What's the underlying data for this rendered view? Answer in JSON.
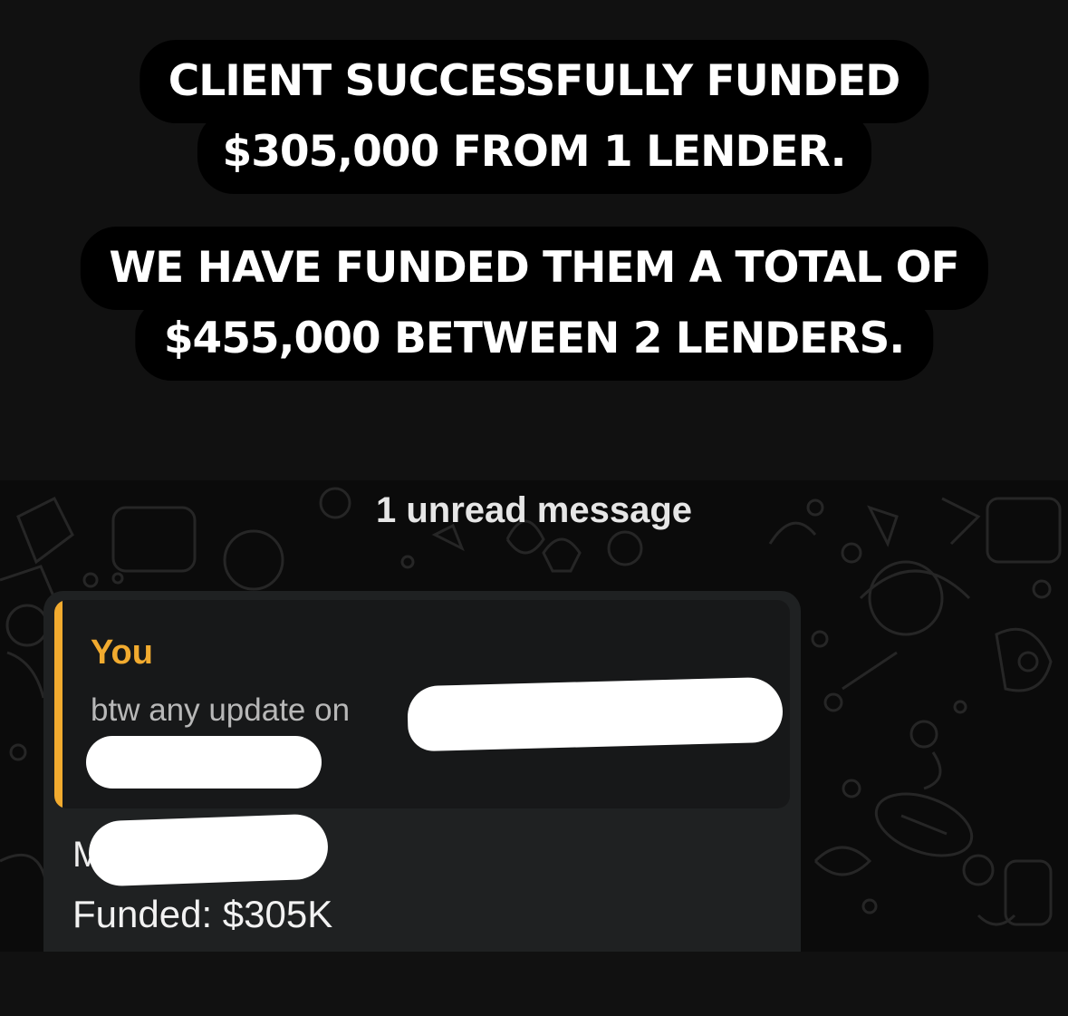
{
  "caption": {
    "line1": "CLIENT SUCCESSFULLY FUNDED",
    "line2": "$305,000 FROM 1 LENDER.",
    "line3": "WE HAVE FUNDED THEM A TOTAL OF",
    "line4": "$455,000 BETWEEN 2 LENDERS."
  },
  "chat": {
    "unread_label": "1 unread message",
    "quote": {
      "author": "You",
      "text": "btw any update on"
    },
    "message": {
      "initial": "M",
      "funded": "Funded: $305K"
    }
  },
  "colors": {
    "accent": "#f2ab2f",
    "caption_bg": "#000000",
    "bubble_bg": "#1f2122"
  }
}
